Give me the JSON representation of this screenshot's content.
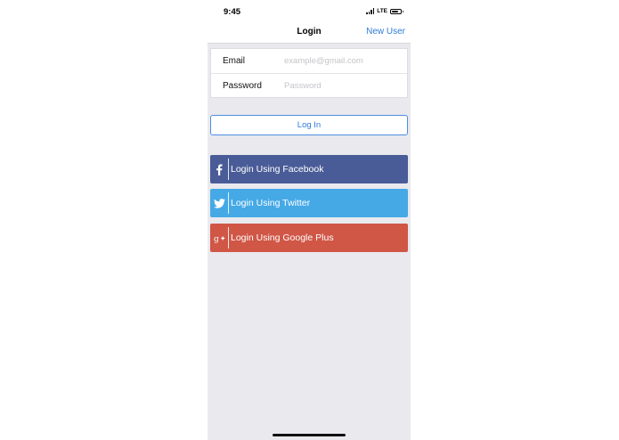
{
  "status_bar": {
    "time": "9:45",
    "network": "LTE"
  },
  "nav": {
    "title": "Login",
    "right_action": "New User"
  },
  "form": {
    "email_label": "Email",
    "email_placeholder": "example@gmail.com",
    "email_value": "",
    "password_label": "Password",
    "password_placeholder": "Password",
    "password_value": ""
  },
  "login_button": {
    "label": "Log In"
  },
  "social": {
    "facebook": {
      "label": "Login Using Facebook",
      "icon": "facebook-icon",
      "color": "#4a5c97"
    },
    "twitter": {
      "label": "Login Using Twitter",
      "icon": "twitter-icon",
      "color": "#45a9e6"
    },
    "google": {
      "label": "Login Using Google Plus",
      "icon": "google-plus-icon",
      "color": "#d05646"
    }
  },
  "colors": {
    "accent": "#2f7bd8",
    "background": "#e9e9ee"
  }
}
